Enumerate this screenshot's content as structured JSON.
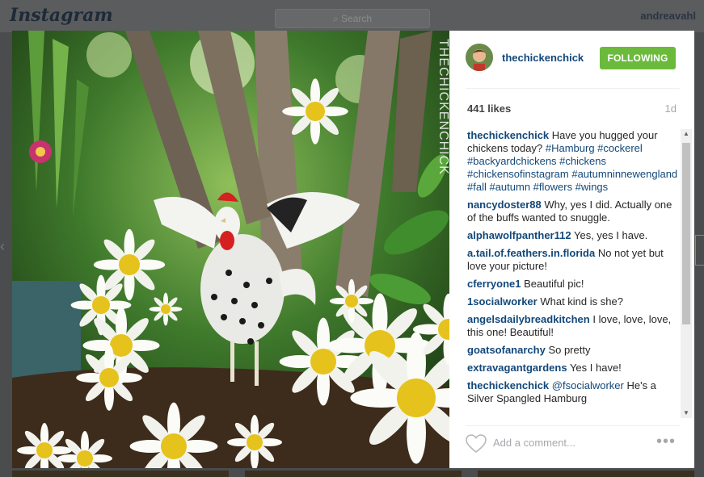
{
  "app": {
    "logo": "Instagram",
    "search_placeholder": "Search",
    "current_user": "andreavahl"
  },
  "post": {
    "username": "thechickenchick",
    "follow_label": "FOLLOWING",
    "likes": "441 likes",
    "time": "1d",
    "watermark": "THECHICKENCHICK",
    "comments": [
      {
        "author": "thechickenchick",
        "text": "Have you hugged your chickens today?",
        "tags": "#Hamburg #cockerel #backyardchickens #chickens #chickensofinstagram #autumninnewengland #fall #autumn #flowers #wings"
      },
      {
        "author": "nancydoster88",
        "text": "Why, yes I did. Actually one of the buffs wanted to snuggle."
      },
      {
        "author": "alphawolfpanther112",
        "text": "Yes, yes I have."
      },
      {
        "author": "a.tail.of.feathers.in.florida",
        "text": "No not yet but love your picture!"
      },
      {
        "author": "cferryone1",
        "text": "Beautiful pic!"
      },
      {
        "author": "1socialworker",
        "text": "What kind is she?"
      },
      {
        "author": "angelsdailybreadkitchen",
        "text": "I love, love, love, this one! Beautiful!"
      },
      {
        "author": "goatsofanarchy",
        "text": "So pretty"
      },
      {
        "author": "extravagantgardens",
        "text": "Yes I have!"
      },
      {
        "author": "thechickenchick",
        "text": "He's a Silver Spangled Hamburg",
        "mention": "@fsocialworker"
      }
    ],
    "add_comment_placeholder": "Add a comment...",
    "more_label": "•••"
  },
  "icons": {
    "heart": "heart-icon",
    "search": "search-icon",
    "more": "more-options-icon"
  },
  "colors": {
    "follow_green": "#6bba3c",
    "link_blue": "#12487a"
  }
}
